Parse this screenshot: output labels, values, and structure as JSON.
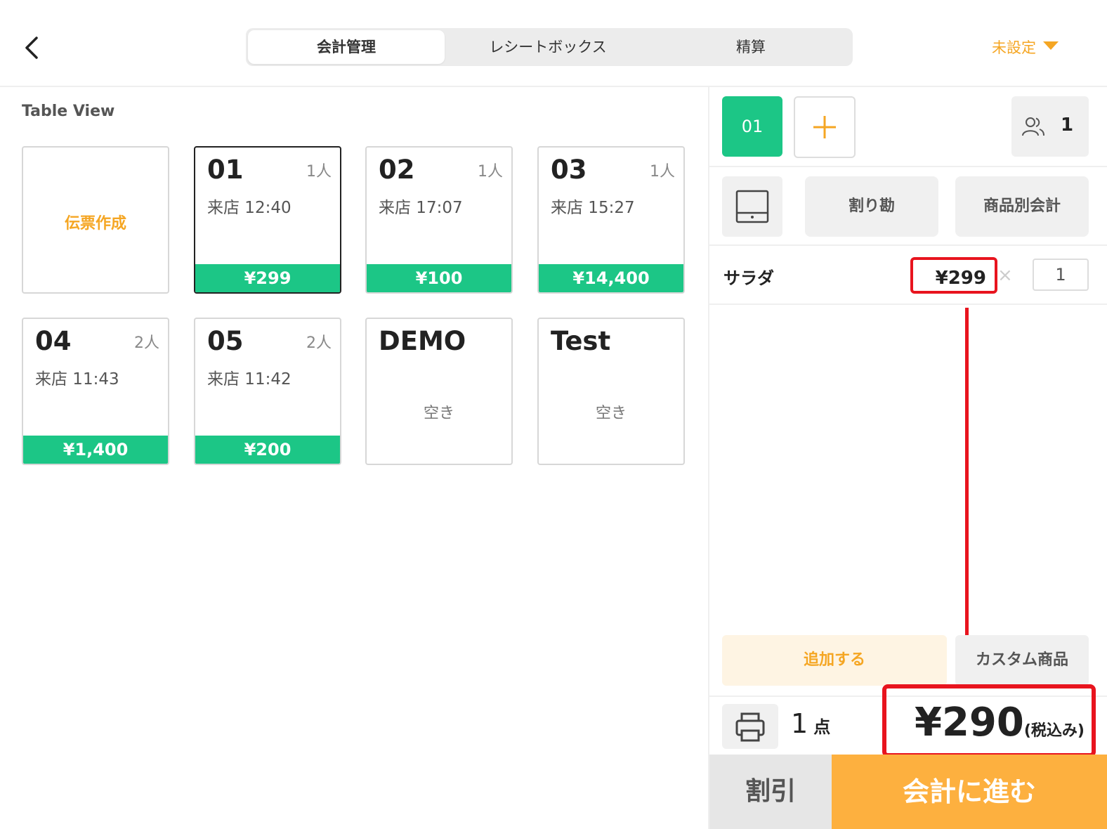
{
  "header": {
    "tabs": [
      {
        "label": "会計管理",
        "active": true
      },
      {
        "label": "レシートボックス",
        "active": false
      },
      {
        "label": "精算",
        "active": false
      }
    ],
    "dropdown_label": "未設定"
  },
  "table_view": {
    "title": "Table View",
    "create_label": "伝票作成",
    "tables": [
      {
        "num": "01",
        "people": "1人",
        "time": "来店 12:40",
        "price": "¥299",
        "selected": true
      },
      {
        "num": "02",
        "people": "1人",
        "time": "来店 17:07",
        "price": "¥100"
      },
      {
        "num": "03",
        "people": "1人",
        "time": "来店 15:27",
        "price": "¥14,400"
      },
      {
        "num": "04",
        "people": "2人",
        "time": "来店 11:43",
        "price": "¥1,400"
      },
      {
        "num": "05",
        "people": "2人",
        "time": "来店 11:42",
        "price": "¥200"
      },
      {
        "num": "DEMO",
        "status": "空き"
      },
      {
        "num": "Test",
        "status": "空き"
      }
    ]
  },
  "order": {
    "table_label": "01",
    "people_count": "1",
    "split_label": "割り勘",
    "by_item_label": "商品別会計",
    "items": [
      {
        "name": "サラダ",
        "price": "¥299",
        "qty": "1"
      }
    ],
    "add_label": "追加する",
    "custom_label": "カスタム商品",
    "count": "1",
    "count_unit": "点",
    "total": "¥290",
    "tax_note": "(税込み)",
    "discount_label": "割引",
    "checkout_label": "会計に進む"
  },
  "colors": {
    "accent_green": "#1cc686",
    "accent_orange": "#f5a623",
    "checkout_orange": "#fdb03f",
    "highlight_red": "#e8141e"
  }
}
